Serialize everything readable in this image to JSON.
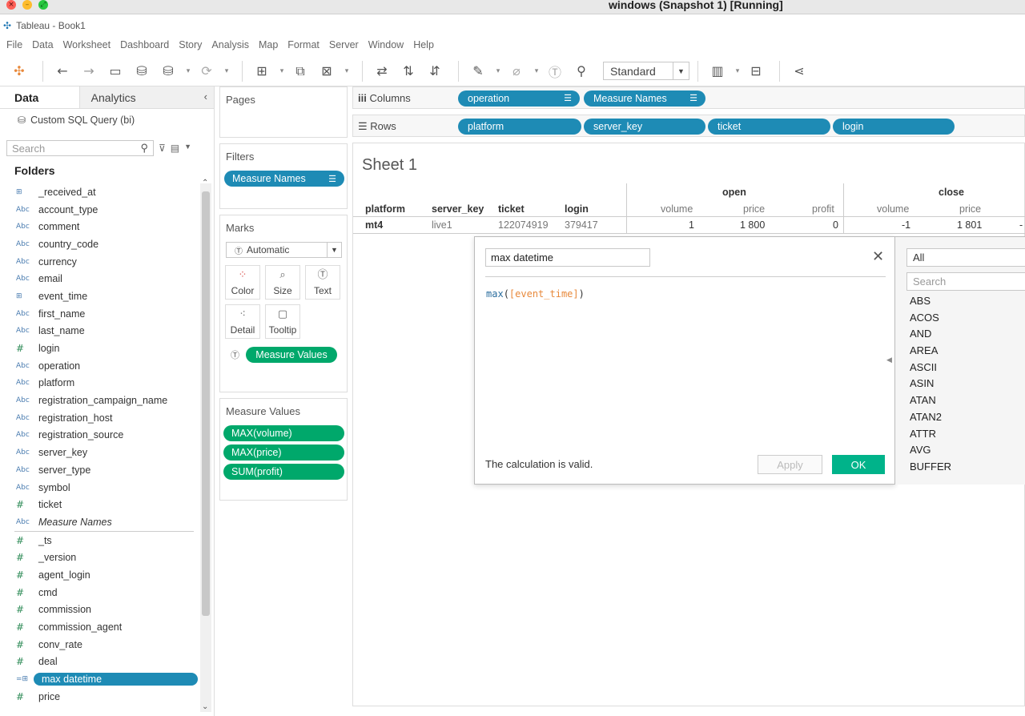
{
  "window": {
    "title": "windows (Snapshot 1) [Running]"
  },
  "app": {
    "title": "Tableau - Book1"
  },
  "menu": [
    "File",
    "Data",
    "Worksheet",
    "Dashboard",
    "Story",
    "Analysis",
    "Map",
    "Format",
    "Server",
    "Window",
    "Help"
  ],
  "toolbar": {
    "fit_select": "Standard"
  },
  "data_pane": {
    "tab_data": "Data",
    "tab_analytics": "Analytics",
    "datasource": "Custom SQL Query (bi)",
    "search_placeholder": "Search",
    "folders_title": "Folders",
    "fields_dimensions": [
      {
        "type": "date",
        "icon": "⊞",
        "name": "_received_at"
      },
      {
        "type": "abc",
        "icon": "Abc",
        "name": "account_type"
      },
      {
        "type": "abc",
        "icon": "Abc",
        "name": "comment"
      },
      {
        "type": "abc",
        "icon": "Abc",
        "name": "country_code"
      },
      {
        "type": "abc",
        "icon": "Abc",
        "name": "currency"
      },
      {
        "type": "abc",
        "icon": "Abc",
        "name": "email"
      },
      {
        "type": "date",
        "icon": "⊞",
        "name": "event_time"
      },
      {
        "type": "abc",
        "icon": "Abc",
        "name": "first_name"
      },
      {
        "type": "abc",
        "icon": "Abc",
        "name": "last_name"
      },
      {
        "type": "num",
        "icon": "#",
        "name": "login"
      },
      {
        "type": "abc",
        "icon": "Abc",
        "name": "operation"
      },
      {
        "type": "abc",
        "icon": "Abc",
        "name": "platform"
      },
      {
        "type": "abc",
        "icon": "Abc",
        "name": "registration_campaign_name"
      },
      {
        "type": "abc",
        "icon": "Abc",
        "name": "registration_host"
      },
      {
        "type": "abc",
        "icon": "Abc",
        "name": "registration_source"
      },
      {
        "type": "abc",
        "icon": "Abc",
        "name": "server_key"
      },
      {
        "type": "abc",
        "icon": "Abc",
        "name": "server_type"
      },
      {
        "type": "abc",
        "icon": "Abc",
        "name": "symbol"
      },
      {
        "type": "num",
        "icon": "#",
        "name": "ticket"
      },
      {
        "type": "abc",
        "icon": "Abc",
        "name": "Measure Names"
      }
    ],
    "fields_measures": [
      {
        "type": "num",
        "icon": "#",
        "name": "_ts"
      },
      {
        "type": "num",
        "icon": "#",
        "name": "_version"
      },
      {
        "type": "num",
        "icon": "#",
        "name": "agent_login"
      },
      {
        "type": "num",
        "icon": "#",
        "name": "cmd"
      },
      {
        "type": "num",
        "icon": "#",
        "name": "commission"
      },
      {
        "type": "num",
        "icon": "#",
        "name": "commission_agent"
      },
      {
        "type": "num",
        "icon": "#",
        "name": "conv_rate"
      },
      {
        "type": "num",
        "icon": "#",
        "name": "deal"
      },
      {
        "type": "calcdate",
        "icon": "=⊞",
        "name": "max datetime"
      },
      {
        "type": "num",
        "icon": "#",
        "name": "price"
      }
    ]
  },
  "pages": {
    "title": "Pages"
  },
  "filters": {
    "title": "Filters",
    "pill": "Measure Names"
  },
  "marks": {
    "title": "Marks",
    "type": "Automatic",
    "buttons": [
      "Color",
      "Size",
      "Text",
      "Detail",
      "Tooltip"
    ],
    "text_pill": "Measure Values"
  },
  "measure_values": {
    "title": "Measure Values",
    "pills": [
      "MAX(volume)",
      "MAX(price)",
      "SUM(profit)"
    ]
  },
  "columns_shelf": {
    "label": "Columns",
    "pills": [
      "operation",
      "Measure Names"
    ]
  },
  "rows_shelf": {
    "label": "Rows",
    "pills": [
      "platform",
      "server_key",
      "ticket",
      "login"
    ]
  },
  "view": {
    "sheet_title": "Sheet 1",
    "group_open": "open",
    "group_close": "close",
    "row_headers": [
      "platform",
      "server_key",
      "ticket",
      "login"
    ],
    "open_cols": [
      "volume",
      "price",
      "profit"
    ],
    "close_cols": [
      "volume",
      "price"
    ],
    "row": {
      "platform": "mt4",
      "server_key": "live1",
      "ticket": "122074919",
      "login": "379417",
      "open_volume": "1",
      "open_price": "1 800",
      "open_profit": "0",
      "close_volume": "-1",
      "close_price": "1 801",
      "close_profit_partial": "-"
    }
  },
  "calc_dialog": {
    "name": "max datetime",
    "expr_fn": "max",
    "expr_field": "[event_time]",
    "status": "The calculation is valid.",
    "apply": "Apply",
    "ok": "OK"
  },
  "function_panel": {
    "category": "All",
    "search_placeholder": "Search",
    "functions": [
      "ABS",
      "ACOS",
      "AND",
      "AREA",
      "ASCII",
      "ASIN",
      "ATAN",
      "ATAN2",
      "ATTR",
      "AVG",
      "BUFFER"
    ]
  }
}
